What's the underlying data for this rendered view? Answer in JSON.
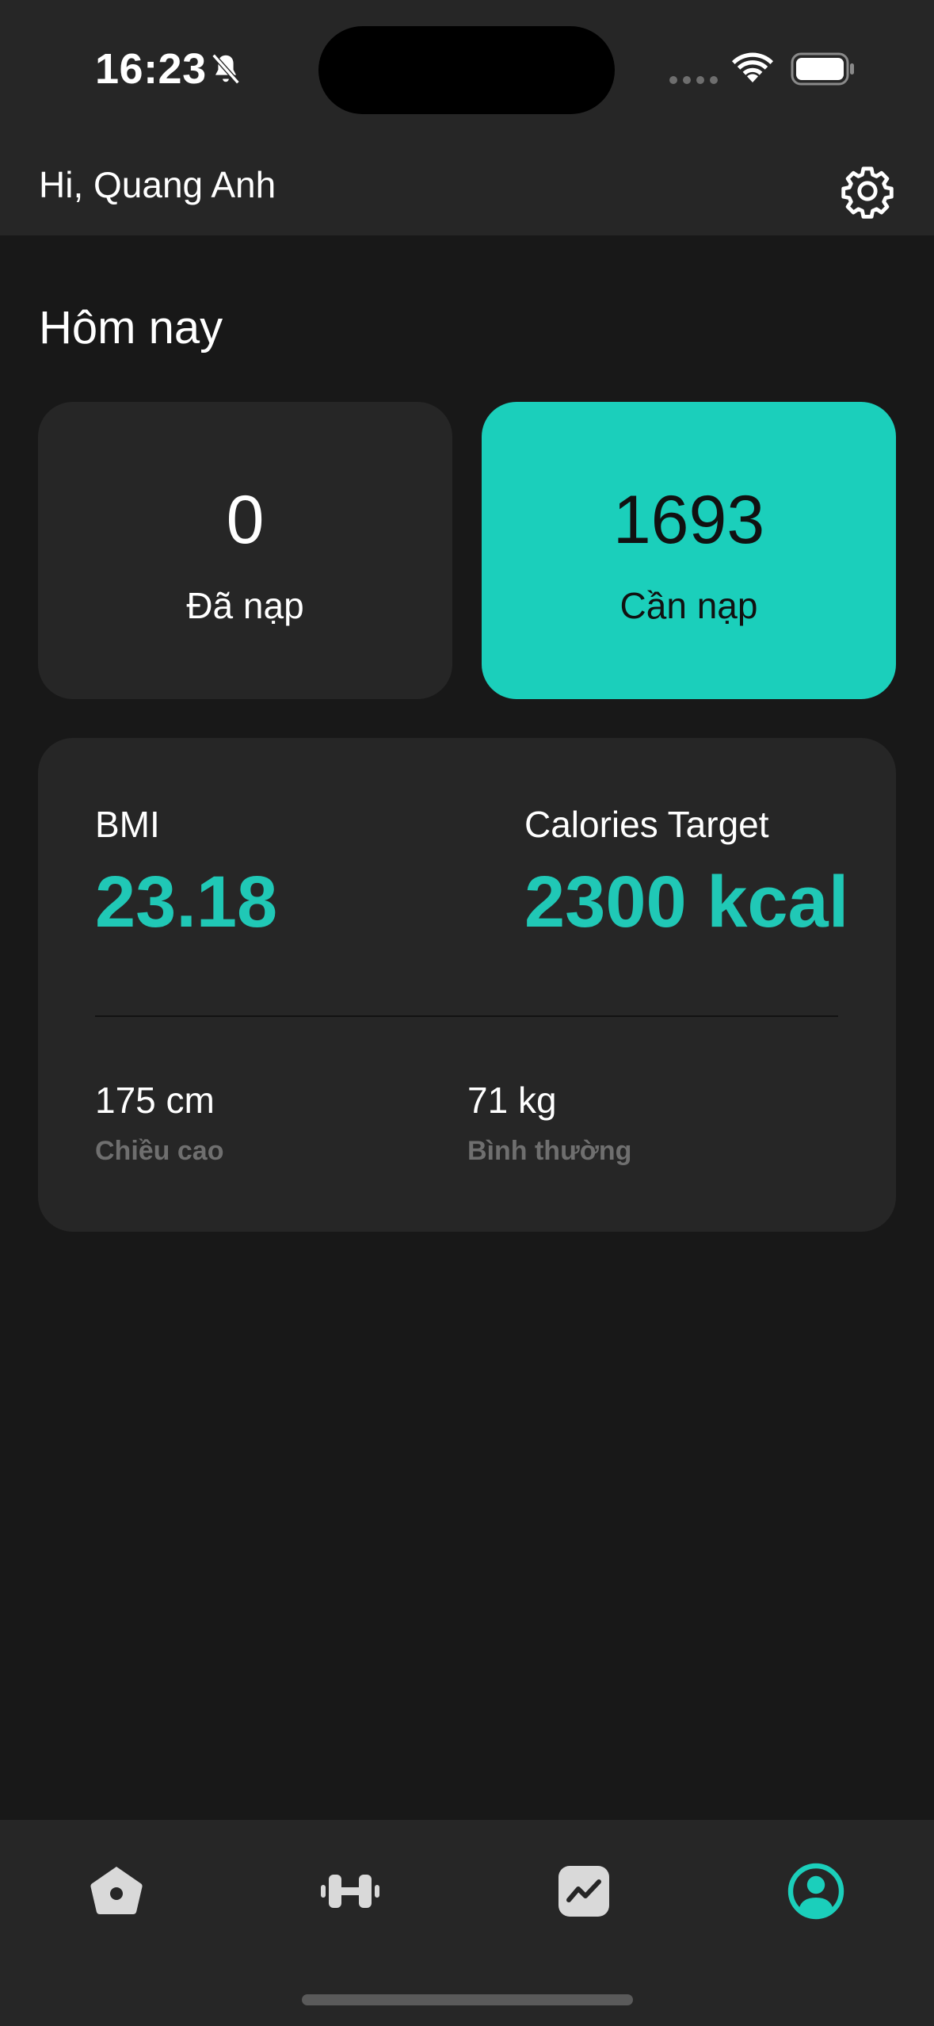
{
  "status_bar": {
    "time": "16:23",
    "icons": [
      "bell-slash-icon",
      "cellular-signal-icon",
      "wifi-icon",
      "battery-icon"
    ]
  },
  "header": {
    "greeting": "Hi, Quang Anh",
    "settings_icon": "gear-icon"
  },
  "today": {
    "title": "Hôm nay",
    "consumed": {
      "value": "0",
      "label": "Đã nạp"
    },
    "remaining": {
      "value": "1693",
      "label": "Cần nạp"
    }
  },
  "summary": {
    "bmi_label": "BMI",
    "bmi_value": "23.18",
    "calories_label": "Calories Target",
    "calories_value": "2300 kcal",
    "height_value": "175 cm",
    "height_label": "Chiều cao",
    "weight_value": "71 kg",
    "weight_label": "Bình thường"
  },
  "nav": {
    "items": [
      "home-icon",
      "dumbbell-icon",
      "chart-icon",
      "profile-icon"
    ],
    "active": "profile-icon"
  },
  "colors": {
    "accent": "#1bcfbb",
    "background": "#181818",
    "surface": "#262626",
    "muted": "#6f6f6f"
  }
}
